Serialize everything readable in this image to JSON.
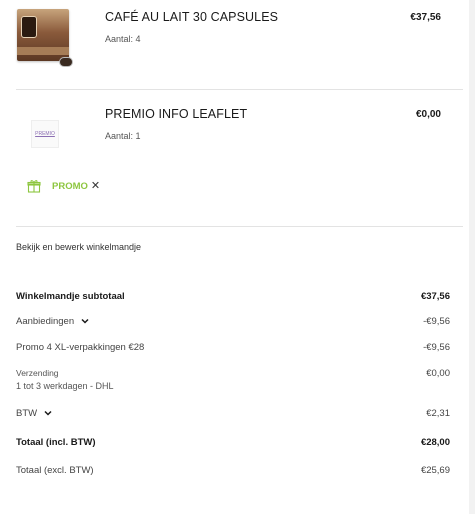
{
  "items": [
    {
      "name": "CAFÉ AU LAIT 30 CAPSULES",
      "qty_label": "Aantal: 4",
      "price": "€37,56"
    },
    {
      "name": "PREMIO INFO LEAFLET",
      "qty_label": "Aantal: 1",
      "price": "€0,00",
      "thumb_text": "PREMIO"
    }
  ],
  "promo": {
    "label": "PROMO",
    "close": "✕"
  },
  "edit_link": "Bekijk en bewerk winkelmandje",
  "summary": {
    "subtotal": {
      "label": "Winkelmandje subtotaal",
      "value": "€37,56"
    },
    "offers": {
      "label": "Aanbiedingen",
      "value": "-€9,56"
    },
    "promo_line": {
      "label": "Promo 4 XL-verpakkingen €28",
      "value": "-€9,56"
    },
    "shipping": {
      "label": "Verzending",
      "sub": "1 tot 3 werkdagen - DHL",
      "value": "€0,00"
    },
    "vat": {
      "label": "BTW",
      "value": "€2,31"
    },
    "total_incl": {
      "label": "Totaal (incl. BTW)",
      "value": "€28,00"
    },
    "total_excl": {
      "label": "Totaal (excl. BTW)",
      "value": "€25,69"
    }
  },
  "colors": {
    "promo_accent": "#8dc63f",
    "text": "#1a1a1a"
  },
  "icons": [
    "gift-icon",
    "close-icon",
    "chevron-down-icon"
  ]
}
